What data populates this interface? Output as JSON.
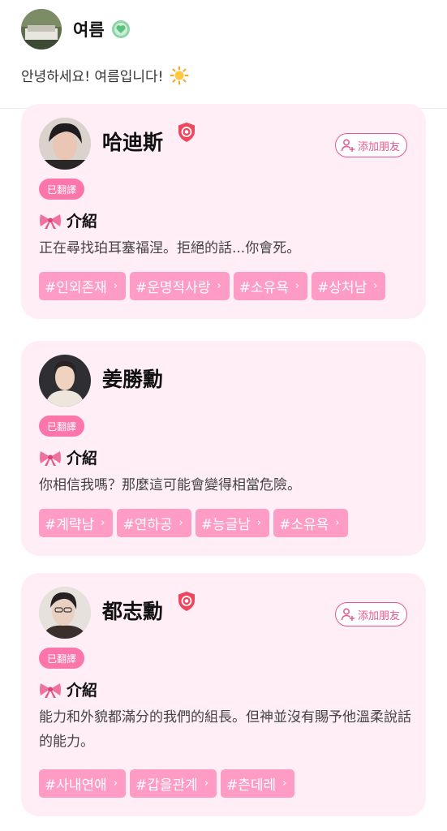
{
  "profile": {
    "name": "여름",
    "greeting": "안녕하세요! 여름입니다!"
  },
  "colors": {
    "accent": "#e8578e",
    "card_bg": "#ffeef5",
    "tag_bg": "#ff9cc6",
    "translated_bg": "#fd76ab"
  },
  "cards": [
    {
      "name": "哈迪斯",
      "verified": true,
      "add_friend_label": "添加朋友",
      "translated_label": "已翻譯",
      "intro_label": "介紹",
      "intro_text": "正在尋找珀耳塞福涅。拒絕的話...你會死。",
      "tags": [
        "#인외존재",
        "#운명적사랑",
        "#소유욕",
        "#상처남"
      ]
    },
    {
      "name": "姜勝勳",
      "verified": false,
      "translated_label": "已翻譯",
      "intro_label": "介紹",
      "intro_text": "你相信我嗎？那麼這可能會變得相當危險。",
      "tags": [
        "#계략남",
        "#연하공",
        "#능글남",
        "#소유욕"
      ]
    },
    {
      "name": "都志勳",
      "verified": true,
      "add_friend_label": "添加朋友",
      "translated_label": "已翻譯",
      "intro_label": "介紹",
      "intro_text": "能力和外貌都滿分的我們的組長。但神並沒有賜予他溫柔說話的能力。",
      "tags": [
        "#사내연애",
        "#갑을관계",
        "#츤데레"
      ]
    }
  ]
}
